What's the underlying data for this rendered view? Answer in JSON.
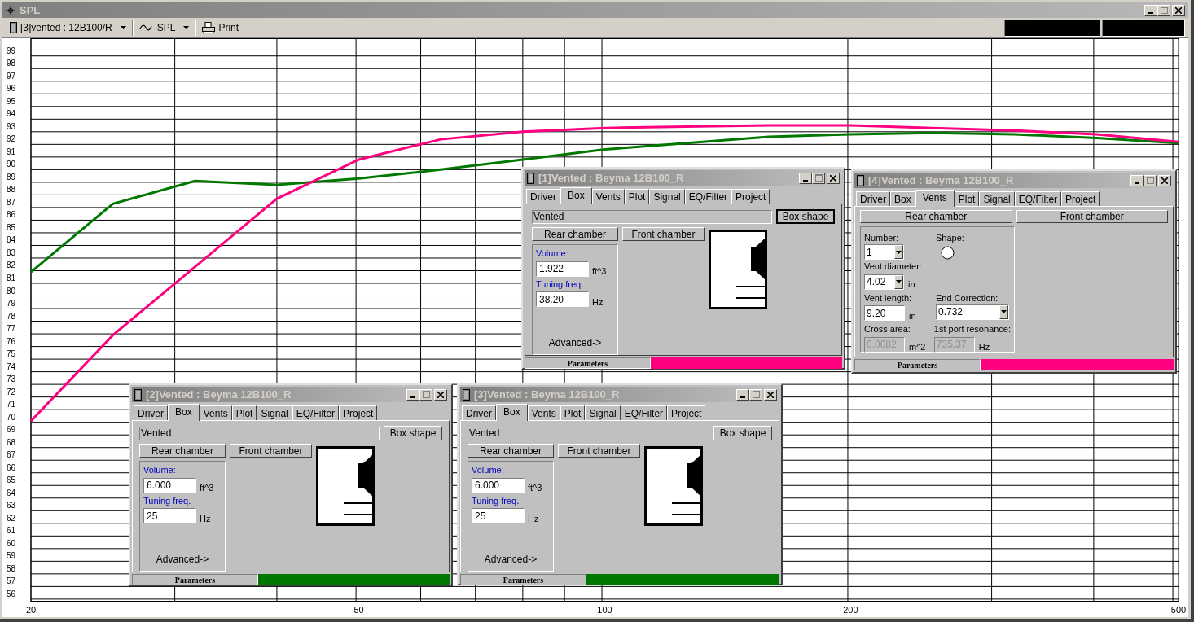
{
  "window": {
    "title": "SPL"
  },
  "toolbar": {
    "items": [
      {
        "kind": "dropdown",
        "label": "[3]vented : 12B100/R"
      },
      {
        "kind": "dropdown",
        "label": "SPL"
      },
      {
        "kind": "button",
        "label": "Print"
      }
    ]
  },
  "chart": {
    "chart_data": {
      "type": "line",
      "categories": [
        "20",
        null,
        null,
        null,
        "50",
        null,
        null,
        "100",
        null,
        null,
        "200",
        null,
        null,
        null,
        "500"
      ],
      "series": [
        {
          "color": "#007800",
          "values": [
            81.9,
            87.3,
            89.1,
            88.8,
            89.3,
            90.0,
            90.8,
            91.6,
            92.1,
            92.6,
            92.8,
            92.9,
            92.8,
            92.5,
            92.1
          ]
        },
        {
          "color": "#ff0080",
          "values": [
            70.1,
            76.9,
            82.3,
            87.7,
            90.8,
            92.4,
            93.0,
            93.3,
            93.4,
            93.5,
            93.5,
            93.3,
            93.1,
            92.8,
            92.2
          ]
        }
      ],
      "ylim": [
        55.8,
        100.4
      ],
      "grid": true,
      "yticks": [
        56,
        57,
        58,
        59,
        60,
        61,
        62,
        63,
        64,
        65,
        66,
        67,
        68,
        69,
        70,
        71,
        72,
        73,
        74,
        75,
        76,
        77,
        78,
        79,
        80,
        81,
        82,
        83,
        84,
        85,
        86,
        87,
        88,
        89,
        90,
        91,
        92,
        93,
        94,
        95,
        96,
        97,
        98,
        99
      ]
    }
  },
  "panels": [
    {
      "title": "[1]Vented : Beyma 12B100_R",
      "tabs": [
        {
          "label": "Driver",
          "selected": false
        },
        {
          "label": "Box",
          "selected": true
        },
        {
          "label": "Vents",
          "selected": false
        },
        {
          "label": "Plot",
          "selected": false
        },
        {
          "label": "Signal",
          "selected": false
        },
        {
          "label": "EQ/Filter",
          "selected": false
        },
        {
          "label": "Project",
          "selected": false
        }
      ],
      "page": {
        "kind": "box",
        "type_field": "Vented",
        "box_shape_button": {
          "label": "Box shape",
          "focused": true
        },
        "chambers": [
          "Rear chamber",
          "Front chamber"
        ],
        "fields": [
          {
            "label": "Volume:",
            "value": "1.922",
            "unit": "ft^3"
          },
          {
            "label": "Tuning freq.",
            "value": "38.20",
            "unit": "Hz"
          }
        ],
        "advanced": "Advanced->"
      },
      "footer": {
        "label": "Parameters",
        "color": "#ff0080"
      }
    },
    {
      "title": "[4]Vented : Beyma 12B100_R",
      "tabs": [
        {
          "label": "Driver",
          "selected": false
        },
        {
          "label": "Box",
          "selected": false
        },
        {
          "label": "Vents",
          "selected": true
        },
        {
          "label": "Plot",
          "selected": false
        },
        {
          "label": "Signal",
          "selected": false
        },
        {
          "label": "EQ/Filter",
          "selected": false
        },
        {
          "label": "Project",
          "selected": false
        }
      ],
      "page": {
        "kind": "vents",
        "chambers": [
          "Rear chamber",
          "Front chamber"
        ],
        "rows": [
          [
            {
              "kind": "dropdown",
              "label": "Number:",
              "value": "1",
              "disabled": false
            },
            {
              "kind": "shape",
              "label": "Shape:"
            }
          ],
          [
            {
              "kind": "dropdown",
              "label": "Vent diameter:",
              "value": "4.02",
              "unit": "in",
              "disabled": false
            }
          ],
          [
            {
              "kind": "input",
              "label": "Vent length:",
              "value": "9.20",
              "unit": "in",
              "disabled": false
            },
            {
              "kind": "dropdown",
              "label": "End Correction:",
              "value": "0.732",
              "disabled": false
            }
          ],
          [
            {
              "kind": "input",
              "label": "Cross area:",
              "value": "0.0082",
              "unit": "m^2",
              "disabled": true
            },
            {
              "kind": "input",
              "label": "1st port resonance:",
              "value": "735.37",
              "unit": "Hz",
              "disabled": true
            }
          ]
        ]
      },
      "footer": {
        "label": "Parameters",
        "color": "#ff0080"
      }
    },
    {
      "title": "[2]Vented : Beyma 12B100_R",
      "tabs": [
        {
          "label": "Driver",
          "selected": false
        },
        {
          "label": "Box",
          "selected": true
        },
        {
          "label": "Vents",
          "selected": false
        },
        {
          "label": "Plot",
          "selected": false
        },
        {
          "label": "Signal",
          "selected": false
        },
        {
          "label": "EQ/Filter",
          "selected": false
        },
        {
          "label": "Project",
          "selected": false
        }
      ],
      "page": {
        "kind": "box",
        "type_field": "Vented",
        "box_shape_button": {
          "label": "Box shape",
          "focused": false
        },
        "chambers": [
          "Rear chamber",
          "Front chamber"
        ],
        "fields": [
          {
            "label": "Volume:",
            "value": "6.000",
            "unit": "ft^3"
          },
          {
            "label": "Tuning freq.",
            "value": "25",
            "unit": "Hz"
          }
        ],
        "advanced": "Advanced->"
      },
      "footer": {
        "label": "Parameters",
        "color": "#007800"
      }
    },
    {
      "title": "[3]Vented : Beyma 12B100_R",
      "tabs": [
        {
          "label": "Driver",
          "selected": false
        },
        {
          "label": "Box",
          "selected": true
        },
        {
          "label": "Vents",
          "selected": false
        },
        {
          "label": "Plot",
          "selected": false
        },
        {
          "label": "Signal",
          "selected": false
        },
        {
          "label": "EQ/Filter",
          "selected": false
        },
        {
          "label": "Project",
          "selected": false
        }
      ],
      "page": {
        "kind": "box",
        "type_field": "Vented",
        "box_shape_button": {
          "label": "Box shape",
          "focused": false
        },
        "chambers": [
          "Rear chamber",
          "Front chamber"
        ],
        "fields": [
          {
            "label": "Volume:",
            "value": "6.000",
            "unit": "ft^3"
          },
          {
            "label": "Tuning freq.",
            "value": "25",
            "unit": "Hz"
          }
        ],
        "advanced": "Advanced->"
      },
      "footer": {
        "label": "Parameters",
        "color": "#007800"
      }
    }
  ]
}
